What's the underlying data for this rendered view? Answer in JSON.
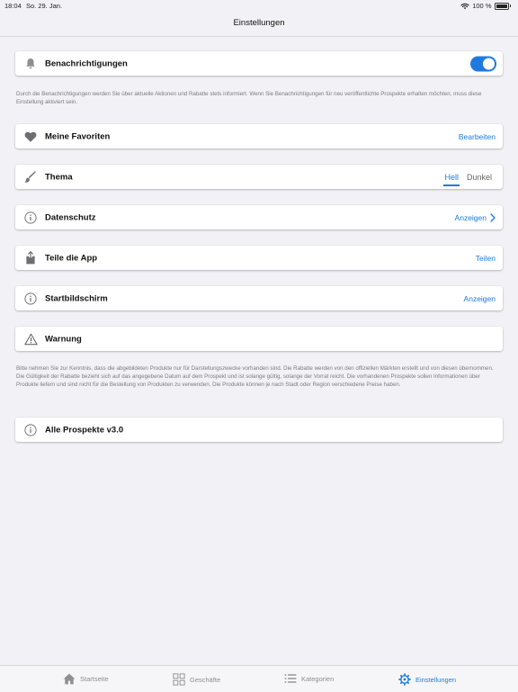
{
  "status": {
    "time": "18:04",
    "date": "So. 29. Jan.",
    "battery": "100 %"
  },
  "nav": {
    "title": "Einstellungen"
  },
  "settings": {
    "notifications": {
      "label": "Benachrichtigungen",
      "enabled": true,
      "icon": "bell-icon"
    },
    "notifications_note": "Durch die Benachrichtigungen werden Sie über aktuelle Aktionen und Rabatte stets informiert. Wenn Sie Benachrichtigungen für neu veröffentlichte Prospekte erhalten möchten, muss diese Einstellung aktiviert sein.",
    "favorites": {
      "label": "Meine Favoriten",
      "action": "Bearbeiten",
      "icon": "heart-icon"
    },
    "theme": {
      "label": "Thema",
      "option_light": "Hell",
      "option_dark": "Dunkel",
      "selected": "Hell",
      "icon": "brush-icon"
    },
    "privacy": {
      "label": "Datenschutz",
      "action": "Anzeigen",
      "icon": "info-icon"
    },
    "share": {
      "label": "Teile die App",
      "action": "Teilen",
      "icon": "share-icon"
    },
    "homescreen": {
      "label": "Startbildschirm",
      "action": "Anzeigen",
      "icon": "info-icon"
    },
    "warning": {
      "label": "Warnung",
      "icon": "warning-icon"
    },
    "warning_note": "Bitte nehmen Sie zur Kenntnis, dass die abgebildeten Produkte nur für Darstellungszwecke vorhanden sind. Die Rabatte werden von den offiziellen Märkten erstellt und von diesen übernommen. Die Gültigkeit der Rabatte bezieht sich auf das angegebene Datum auf dem Prospekt und ist solange gültig, solange der Vorrat reicht. Die vorhandenen Prospekte sollen Informationen über Produkte liefern und sind nicht für die Bestellung von Produkten zu verwenden. Die Produkte können je nach Stadt oder Region verschiedene Preise haben.",
    "about": {
      "label": "Alle Prospekte v3.0",
      "icon": "info-icon"
    }
  },
  "colors": {
    "accent": "#1f7ae0",
    "icon_gray": "#8e8e93",
    "background": "#f2f2f6"
  },
  "tabs": [
    {
      "label": "Startseite",
      "icon": "house-icon",
      "active": false
    },
    {
      "label": "Geschäfte",
      "icon": "grid-icon",
      "active": false
    },
    {
      "label": "Kategorien",
      "icon": "list-icon",
      "active": false
    },
    {
      "label": "Einstellungen",
      "icon": "gear-icon",
      "active": true
    }
  ]
}
